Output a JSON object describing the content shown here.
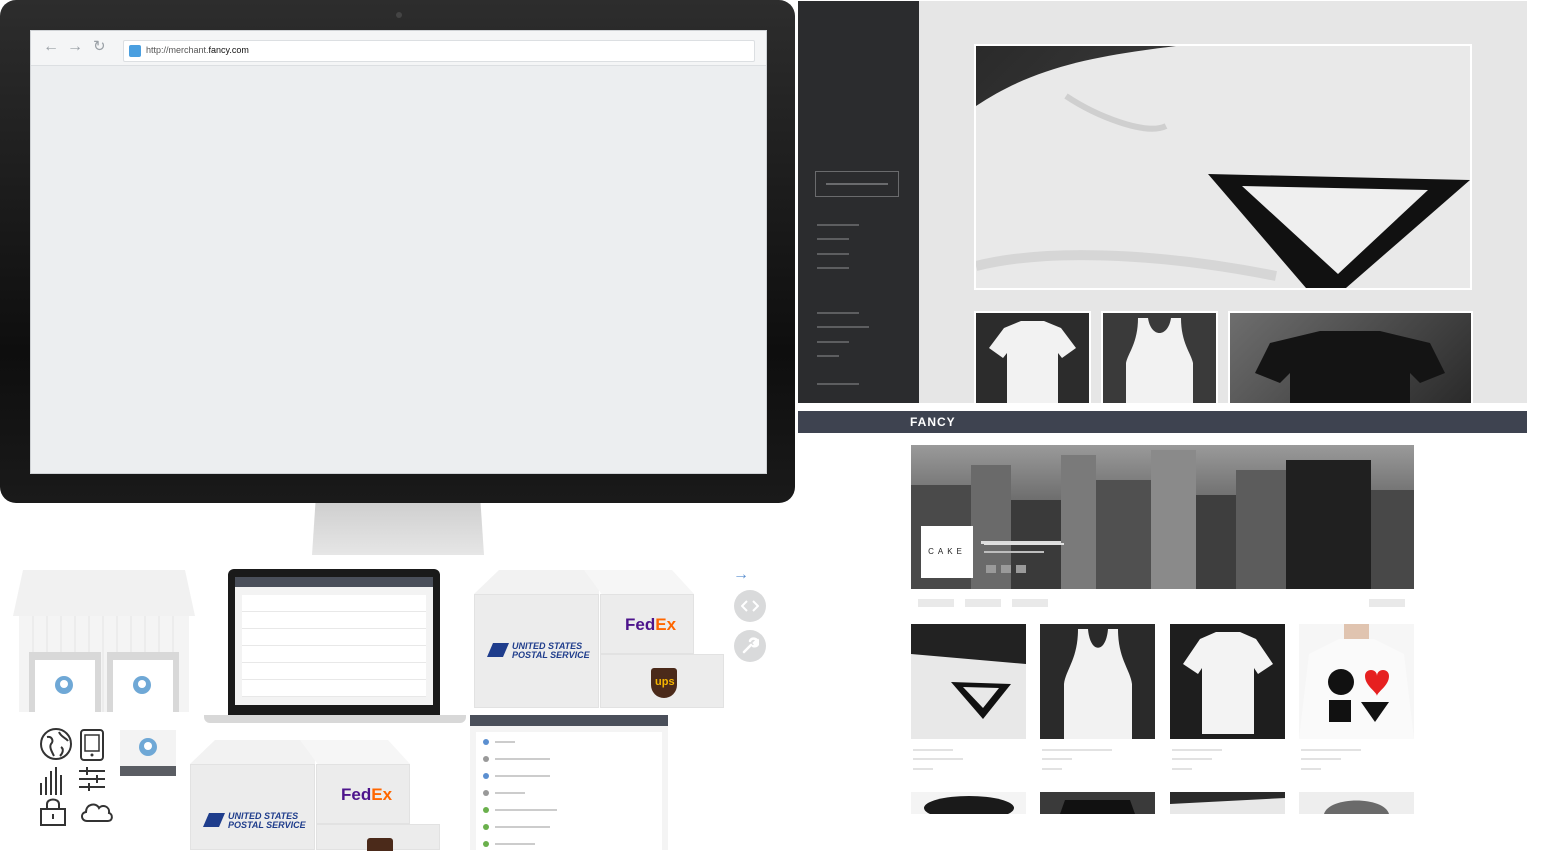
{
  "browser": {
    "url_prefix": "http://merchant.",
    "url_domain": "fancy.com"
  },
  "store": {
    "logo": "FANCY",
    "hero_badge": "CAKE"
  },
  "shipping": {
    "usps_line1": "UNITED STATES",
    "usps_line2": "POSTAL SERVICE",
    "fedex_fed": "Fed",
    "fedex_ex": "Ex",
    "ups": "ups"
  },
  "colors": {
    "fedex_purple": "#4d148c",
    "fedex_orange": "#ff6600",
    "usps_blue": "#1f3d8c",
    "ups_brown": "#4b2a1a",
    "ups_gold": "#f4b400",
    "accent_blue": "#4a9fe0",
    "store_bar": "#3e4350"
  },
  "icons": [
    "back-arrow-icon",
    "forward-arrow-icon",
    "reload-icon",
    "favicon-icon",
    "arrow-right-icon",
    "code-icon",
    "wrench-icon",
    "globe-icon",
    "tablet-icon",
    "bar-chart-icon",
    "sliders-icon",
    "lock-icon",
    "cloud-icon",
    "location-pin-icon"
  ]
}
